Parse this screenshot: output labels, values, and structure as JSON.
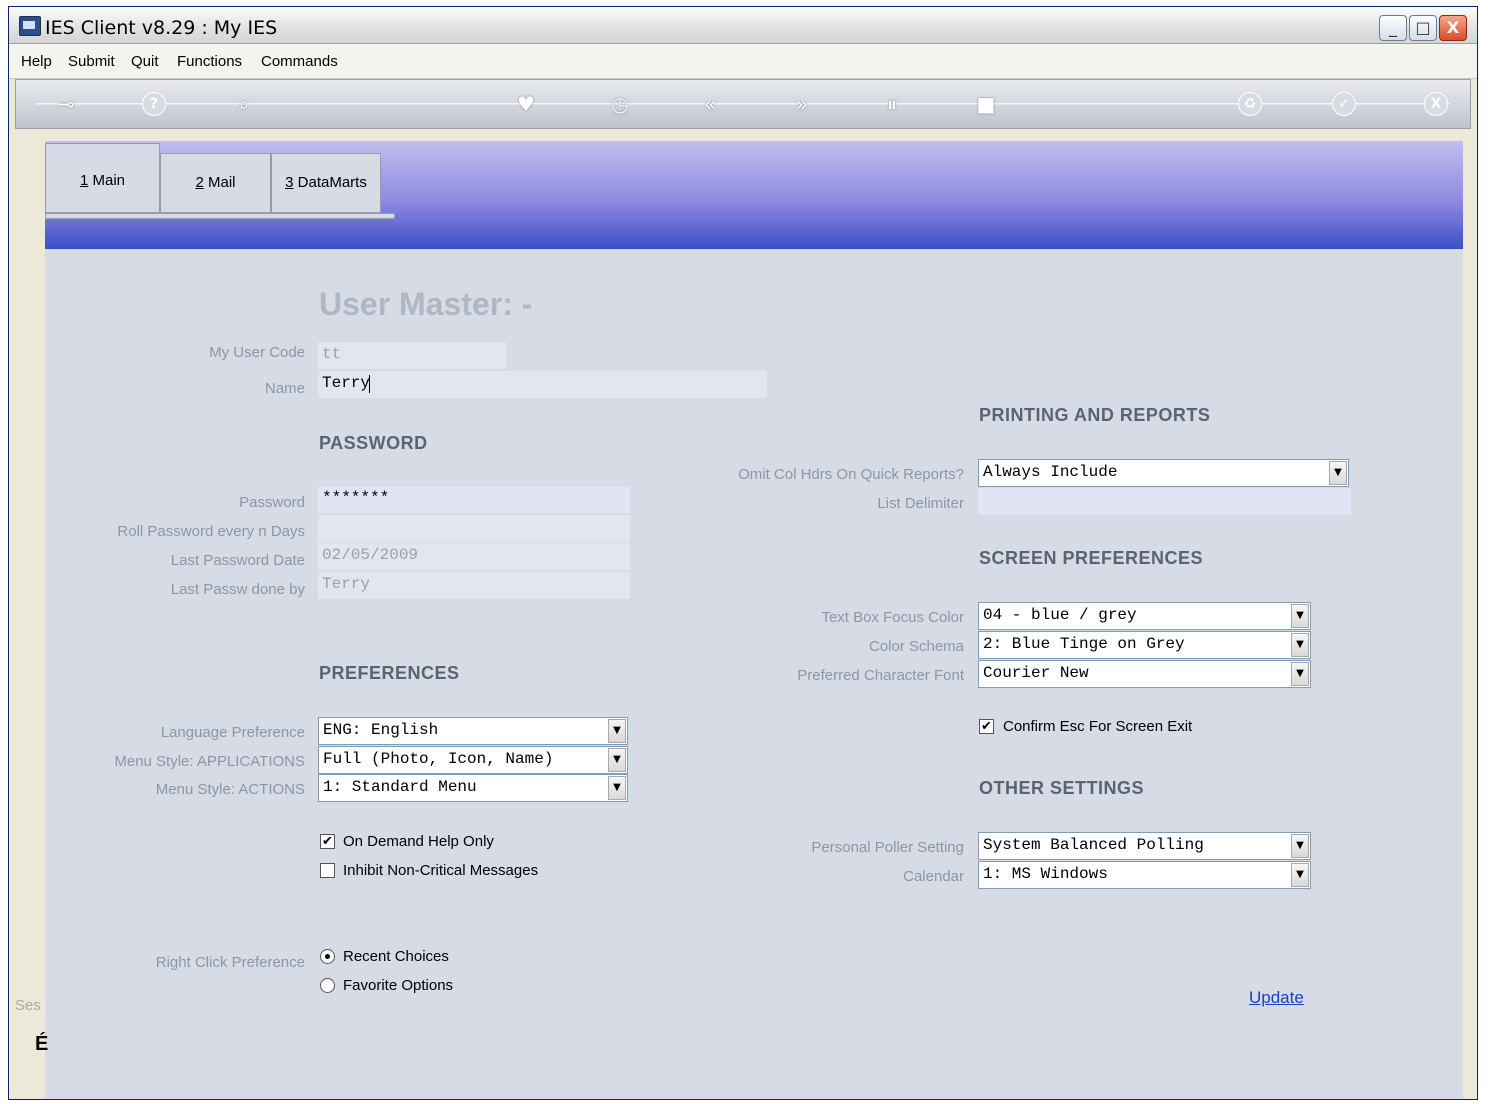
{
  "window": {
    "title": "IES Client v8.29 : My IES",
    "controls": {
      "minimize": "_",
      "maximize": "□",
      "close": "X"
    }
  },
  "menubar": [
    "Help",
    "Submit",
    "Quit",
    "Functions",
    "Commands"
  ],
  "toolbar": {
    "icons": [
      "key-icon",
      "help-icon",
      "search-icon",
      "heart-icon",
      "clock-icon",
      "back-icon",
      "forward-icon",
      "pause-icon",
      "stop-icon",
      "recycle-icon",
      "check-icon",
      "close-icon"
    ],
    "help_glyph": "?",
    "back_glyph": "«",
    "forward_glyph": "»",
    "check_glyph": "✓",
    "close_glyph": "X"
  },
  "tabs": [
    {
      "key": "1",
      "label": " Main"
    },
    {
      "key": "2",
      "label": " Mail"
    },
    {
      "key": "3",
      "label": " DataMarts"
    }
  ],
  "left_strip": {
    "text": "Ses",
    "glyph": "É"
  },
  "page_title": "User Master: -",
  "user": {
    "code_label": "My User Code",
    "code_value": "tt",
    "name_label": "Name",
    "name_value": "Terry"
  },
  "password": {
    "section": "PASSWORD",
    "password_label": "Password",
    "password_value": "*******",
    "roll_label": "Roll Password every n Days",
    "roll_value": "",
    "last_date_label": "Last Password Date",
    "last_date_value": "02/05/2009",
    "last_by_label": "Last Passw done by",
    "last_by_value": "Terry"
  },
  "preferences": {
    "section": "PREFERENCES",
    "language_label": "Language Preference",
    "language_value": "ENG: English",
    "menu_apps_label": "Menu Style: APPLICATIONS",
    "menu_apps_value": "Full (Photo, Icon, Name)",
    "menu_actions_label": "Menu Style: ACTIONS",
    "menu_actions_value": "1: Standard Menu",
    "on_demand_help": {
      "label": "On Demand Help Only",
      "checked": true
    },
    "inhibit_messages": {
      "label": "Inhibit Non-Critical Messages",
      "checked": false
    },
    "right_click_label": "Right Click Preference",
    "right_click_options": [
      {
        "label": "Recent Choices",
        "selected": true
      },
      {
        "label": "Favorite Options",
        "selected": false
      }
    ]
  },
  "printing": {
    "section": "PRINTING AND REPORTS",
    "omit_label": "Omit Col Hdrs On Quick Reports?",
    "omit_value": "Always Include",
    "delimiter_label": "List Delimiter",
    "delimiter_value": ""
  },
  "screen": {
    "section": "SCREEN PREFERENCES",
    "focus_color_label": "Text Box Focus Color",
    "focus_color_value": "04 - blue / grey",
    "schema_label": "Color Schema",
    "schema_value": "2: Blue Tinge on Grey",
    "font_label": "Preferred Character Font",
    "font_value": "Courier New",
    "confirm_esc": {
      "label": "Confirm Esc For Screen Exit",
      "checked": true
    }
  },
  "other": {
    "section": "OTHER SETTINGS",
    "poller_label": "Personal Poller Setting",
    "poller_value": "System Balanced Polling",
    "calendar_label": "Calendar",
    "calendar_value": "1: MS Windows"
  },
  "update_link": "Update",
  "glyphs": {
    "check": "✔",
    "dropdown": "▼"
  }
}
